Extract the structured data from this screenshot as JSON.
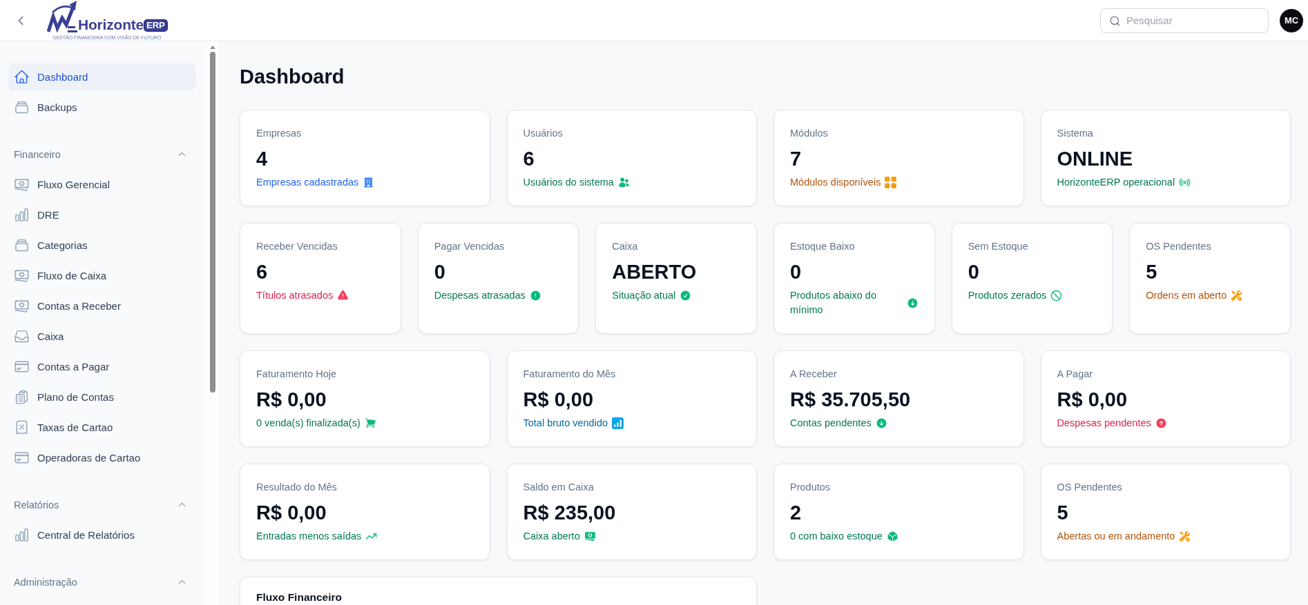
{
  "header": {
    "brand": {
      "name": "Horizonte",
      "badge": "ERP",
      "tagline": "GESTÃO FINANCEIRA COM VISÃO DE FUTURO"
    },
    "search": {
      "placeholder": "Pesquisar"
    },
    "avatar": "MC"
  },
  "sidebar": {
    "items": [
      {
        "label": "Dashboard",
        "selected": true
      },
      {
        "label": "Backups",
        "selected": false
      }
    ],
    "sections": [
      {
        "title": "Financeiro",
        "expanded": true,
        "items": [
          {
            "label": "Fluxo Gerencial",
            "selected": false
          },
          {
            "label": "DRE",
            "selected": false
          },
          {
            "label": "Categorias",
            "selected": false
          },
          {
            "label": "Fluxo de Caixa",
            "selected": false
          },
          {
            "label": "Contas a Receber",
            "selected": false
          },
          {
            "label": "Caixa",
            "selected": false
          },
          {
            "label": "Contas a Pagar",
            "selected": false
          },
          {
            "label": "Plano de Contas",
            "selected": false
          },
          {
            "label": "Taxas de Cartao",
            "selected": false
          },
          {
            "label": "Operadoras de Cartao",
            "selected": false
          }
        ]
      },
      {
        "title": "Relatórios",
        "expanded": true,
        "items": [
          {
            "label": "Central de Relatórios",
            "selected": false
          }
        ]
      },
      {
        "title": "Administração",
        "expanded": true
      }
    ]
  },
  "page": {
    "title": "Dashboard"
  },
  "stat_rows": [
    {
      "cards": [
        {
          "label": "Empresas",
          "value": "4",
          "note": "Empresas cadastradas",
          "color": "#2563eb"
        },
        {
          "label": "Usuários",
          "value": "6",
          "note": "Usuários do sistema",
          "color": "#047857"
        },
        {
          "label": "Módulos",
          "value": "7",
          "note": "Módulos disponíveis",
          "color": "#b45309"
        },
        {
          "label": "Sistema",
          "value": "ONLINE",
          "note": "HorizonteERP operacional",
          "color": "#047857"
        }
      ]
    },
    {
      "cards": [
        {
          "label": "Receber Vencidas",
          "value": "6",
          "note": "Títulos atrasados",
          "color": "#e11d48"
        },
        {
          "label": "Pagar Vencidas",
          "value": "0",
          "note": "Despesas atrasadas",
          "color": "#047857"
        },
        {
          "label": "Caixa",
          "value": "ABERTO",
          "note": "Situação atual",
          "color": "#047857"
        },
        {
          "label": "Estoque Baixo",
          "value": "0",
          "note": "Produtos abaixo do mínimo",
          "color": "#047857"
        },
        {
          "label": "Sem Estoque",
          "value": "0",
          "note": "Produtos zerados",
          "color": "#047857"
        },
        {
          "label": "OS Pendentes",
          "value": "5",
          "note": "Ordens em aberto",
          "color": "#b45309"
        }
      ]
    },
    {
      "cards": [
        {
          "label": "Faturamento Hoje",
          "value": "R$ 0,00",
          "note": "0 venda(s) finalizada(s)",
          "color": "#047857"
        },
        {
          "label": "Faturamento do Mês",
          "value": "R$ 0,00",
          "note": "Total bruto vendido",
          "color": "#0369a1"
        },
        {
          "label": "A Receber",
          "value": "R$ 35.705,50",
          "note": "Contas pendentes",
          "color": "#047857"
        },
        {
          "label": "A Pagar",
          "value": "R$ 0,00",
          "note": "Despesas pendentes",
          "color": "#e11d48"
        }
      ]
    },
    {
      "cards": [
        {
          "label": "Resultado do Mês",
          "value": "R$ 0,00",
          "note": "Entradas menos saídas",
          "color": "#047857"
        },
        {
          "label": "Saldo em Caixa",
          "value": "R$ 235,00",
          "note": "Caixa aberto",
          "color": "#047857"
        },
        {
          "label": "Produtos",
          "value": "2",
          "note": "0 com baixo estoque",
          "color": "#047857"
        },
        {
          "label": "OS Pendentes",
          "value": "5",
          "note": "Abertas ou em andamento",
          "color": "#b45309"
        }
      ]
    }
  ],
  "panels": [
    {
      "title": "Fluxo Financeiro"
    }
  ]
}
